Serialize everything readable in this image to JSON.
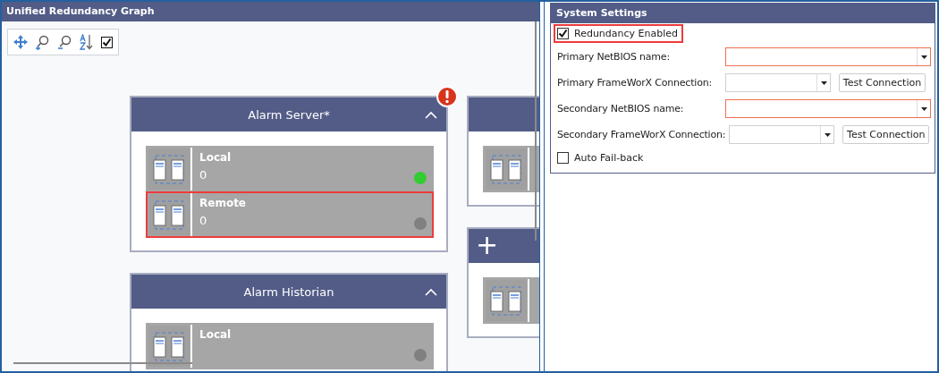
{
  "graph_panel": {
    "title": "Unified Redundancy Graph",
    "toolbar": [
      {
        "kind": "pan"
      },
      {
        "kind": "zoom-in"
      },
      {
        "kind": "zoom-out"
      },
      {
        "kind": "sort"
      },
      {
        "kind": "checkbox",
        "checked": true
      }
    ],
    "cards": [
      {
        "kind": "group",
        "title": "Alarm Server*",
        "expanded": true,
        "error": true,
        "nodes": [
          {
            "name": "Local",
            "value": "0",
            "color": "#33cc33",
            "selected": false
          },
          {
            "name": "Remote",
            "value": "0",
            "color": "#808080",
            "selected": true
          }
        ]
      },
      {
        "kind": "partial",
        "nodes": [
          {
            "selected": false
          }
        ]
      },
      {
        "kind": "add",
        "symbol": "+",
        "nodes": [
          {
            "selected": false
          }
        ]
      },
      {
        "kind": "group",
        "title": "Alarm Historian",
        "expanded": true,
        "error": false,
        "nodes": [
          {
            "name": "Local",
            "color": "#808080",
            "selected": false
          }
        ]
      }
    ]
  },
  "settings_panel": {
    "title": "System Settings",
    "rows": [
      {
        "kind": "checkbox",
        "label": "Redundancy Enabled",
        "checked": true,
        "highlighted": true
      },
      {
        "kind": "combo",
        "label": "Primary NetBIOS name:",
        "invalid": true
      },
      {
        "kind": "combo-test",
        "label": "Primary FrameWorX Connection:",
        "invalid": false,
        "button": "Test Connection"
      },
      {
        "kind": "combo",
        "label": "Secondary NetBIOS name:",
        "invalid": true
      },
      {
        "kind": "combo-test",
        "label": "Secondary FrameWorX Connection:",
        "invalid": false,
        "button": "Test Connection"
      },
      {
        "kind": "checkbox",
        "label": "Auto Fail-back",
        "checked": false,
        "highlighted": false
      }
    ]
  }
}
